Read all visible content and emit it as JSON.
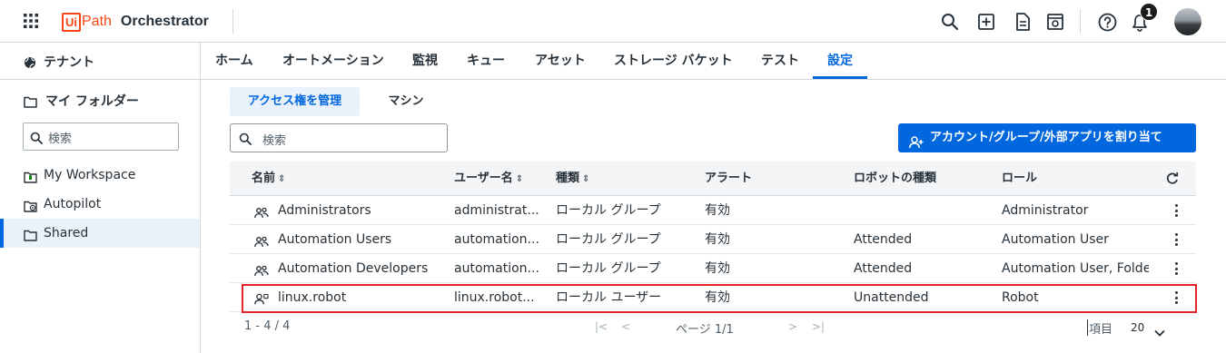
{
  "topbar": {
    "brand_ui": "Ui",
    "brand_path": "Path",
    "product": "Orchestrator",
    "notification_count": "1",
    "icons": [
      "apps-grid-icon",
      "search-icon",
      "add-icon",
      "document-icon",
      "studio-web-icon",
      "help-icon",
      "bell-icon",
      "user-avatar"
    ]
  },
  "sidebar": {
    "tenant_label": "テナント",
    "my_folder_label": "マイ フォルダー",
    "search_placeholder": "検索",
    "folders": [
      {
        "label": "My Workspace",
        "icon": "workspace-folder-icon"
      },
      {
        "label": "Autopilot",
        "icon": "autopilot-folder-icon"
      },
      {
        "label": "Shared",
        "icon": "folder-icon",
        "selected": true
      }
    ]
  },
  "tabs": [
    "ホーム",
    "オートメーション",
    "監視",
    "キュー",
    "アセット",
    "ストレージ バケット",
    "テスト",
    "設定"
  ],
  "active_tab": "設定",
  "subtabs": [
    "アクセス権を管理",
    "マシン"
  ],
  "active_subtab": "アクセス権を管理",
  "search": {
    "placeholder": "検索"
  },
  "assign_button": "アカウント/グループ/外部アプリを割り当て",
  "table": {
    "headers": [
      "名前",
      "ユーザー名",
      "種類",
      "アラート",
      "ロボットの種類",
      "ロール"
    ],
    "rows": [
      {
        "name": "Administrators",
        "username": "administrat...",
        "type": "ローカル グループ",
        "alerts": "有効",
        "robot_type": "",
        "roles": "Administrator",
        "icon": "group-icon"
      },
      {
        "name": "Automation Users",
        "username": "automation...",
        "type": "ローカル グループ",
        "alerts": "有効",
        "robot_type": "Attended",
        "roles": "Automation User",
        "icon": "group-icon"
      },
      {
        "name": "Automation Developers",
        "username": "automation...",
        "type": "ローカル グループ",
        "alerts": "有効",
        "robot_type": "Attended",
        "roles": "Automation User, Folder",
        "icon": "group-icon"
      },
      {
        "name": "linux.robot",
        "username": "linux.robot...",
        "type": "ローカル ユーザー",
        "alerts": "有効",
        "robot_type": "Unattended",
        "roles": "Robot",
        "icon": "user-robot-icon",
        "highlighted": true
      }
    ]
  },
  "pagination": {
    "range": "1 - 4 / 4",
    "page": "ページ 1/1",
    "items_label": "項目",
    "page_size": "20"
  },
  "colors": {
    "accent": "#0067df",
    "brand": "#fa4616",
    "highlight_border": "#e0262b",
    "selected_bg": "#e9f1fa"
  }
}
